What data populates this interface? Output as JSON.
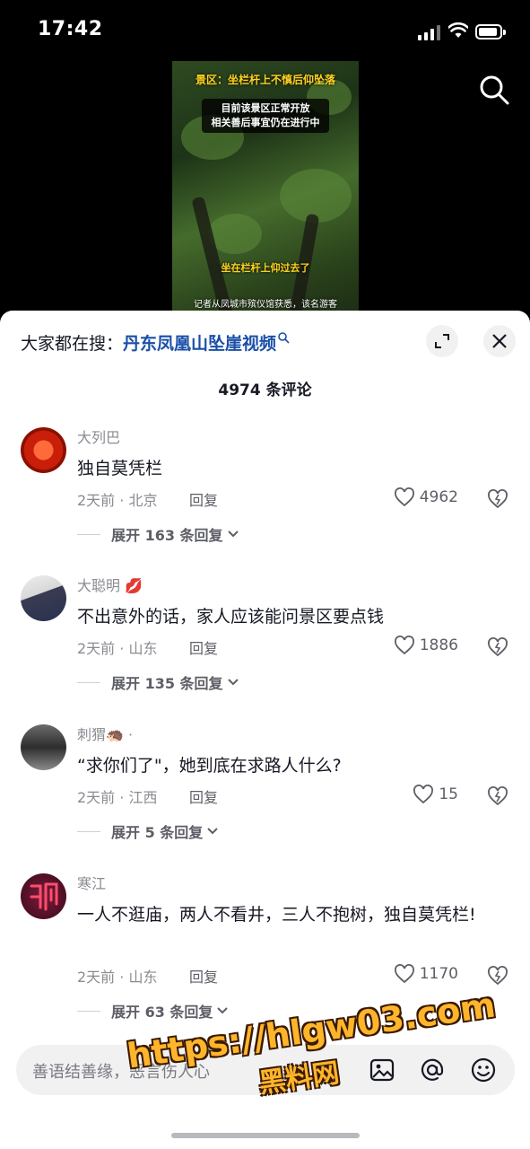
{
  "status_bar": {
    "time": "17:42"
  },
  "video": {
    "title": "景区：坐栏杆上不慎后仰坠落",
    "notice_line1": "目前该景区正常开放",
    "notice_line2": "相关善后事宜仍在进行中",
    "caption_mid": "坐在栏杆上仰过去了",
    "caption_bottom": "记者从凤城市殡仪馆获悉，该名游客"
  },
  "hot_search": {
    "prefix": "大家都在搜：",
    "keyword": "丹东凤凰山坠崖视频"
  },
  "comment_count": "4974 条评论",
  "comments": [
    {
      "user": "大列巴",
      "badge": "",
      "text": "独自莫凭栏",
      "meta": "2天前 · 北京",
      "reply": "回复",
      "likes": "4962",
      "more": "展开 163 条回复"
    },
    {
      "user": "大聪明",
      "badge": "💋",
      "text": "不出意外的话，家人应该能问景区要点钱",
      "meta": "2天前 · 山东",
      "reply": "回复",
      "likes": "1886",
      "more": "展开 135 条回复"
    },
    {
      "user": "刺猬",
      "badge": "🦔 ·",
      "text": "“求你们了\"，她到底在求路人什么?",
      "meta": "2天前 · 江西",
      "reply": "回复",
      "likes": "15",
      "more": "展开 5 条回复"
    },
    {
      "user": "寒江",
      "badge": "",
      "text": "一人不逛庙，两人不看井，三人不抱树，独自莫凭栏!",
      "meta": "2天前 · 山东",
      "reply": "回复",
      "likes": "1170",
      "more": "展开 63 条回复"
    }
  ],
  "input": {
    "placeholder": "善语结善缘，恶言伤人心"
  },
  "watermark": {
    "url": "https://hlgw03.com",
    "name": "黑料网"
  },
  "icons": [
    "search-icon",
    "expand-icon",
    "close-icon",
    "heart-icon",
    "dislike-icon",
    "image-icon",
    "at-icon",
    "emoji-icon"
  ]
}
